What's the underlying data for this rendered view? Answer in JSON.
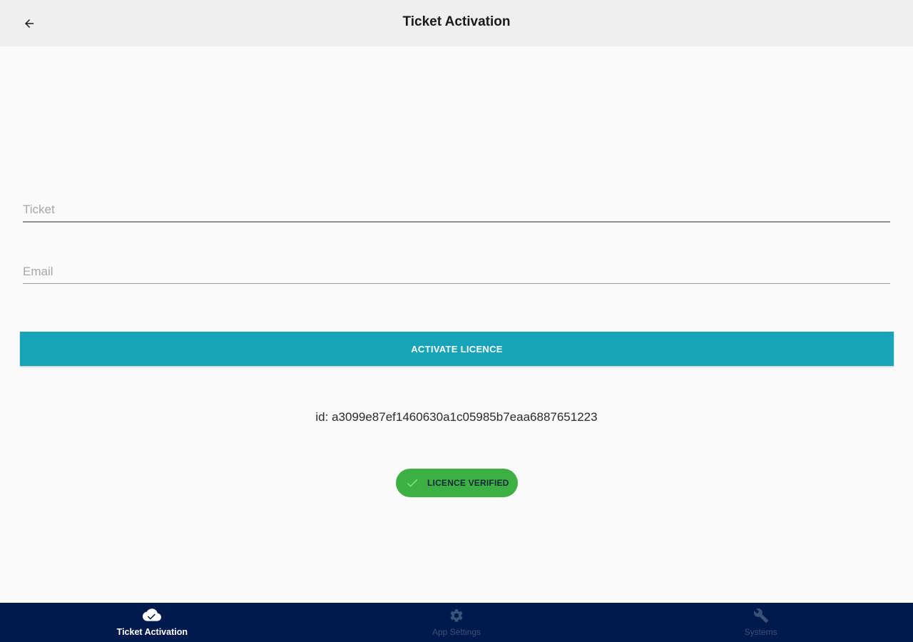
{
  "header": {
    "title": "Ticket Activation",
    "back_icon": "arrow-left-icon"
  },
  "form": {
    "ticket_placeholder": "Ticket",
    "ticket_value": "",
    "email_placeholder": "Email",
    "email_value": "",
    "activate_label": "ACTIVATE LICENCE"
  },
  "device_id": "id: a3099e87ef1460630a1c05985b7eaa6887651223",
  "status": {
    "label": "LICENCE VERIFIED",
    "icon": "check-icon",
    "color": "#3cb043"
  },
  "bottom_nav": {
    "items": [
      {
        "label": "Ticket Activation",
        "icon": "cloud-check-icon",
        "active": true
      },
      {
        "label": "App Settings",
        "icon": "gear-icon",
        "active": false
      },
      {
        "label": "Systems",
        "icon": "wrench-icon",
        "active": false
      }
    ]
  },
  "colors": {
    "accent": "#17a3b8",
    "nav_background": "#001a4d",
    "header_background": "#efefef",
    "success": "#3cb043"
  }
}
